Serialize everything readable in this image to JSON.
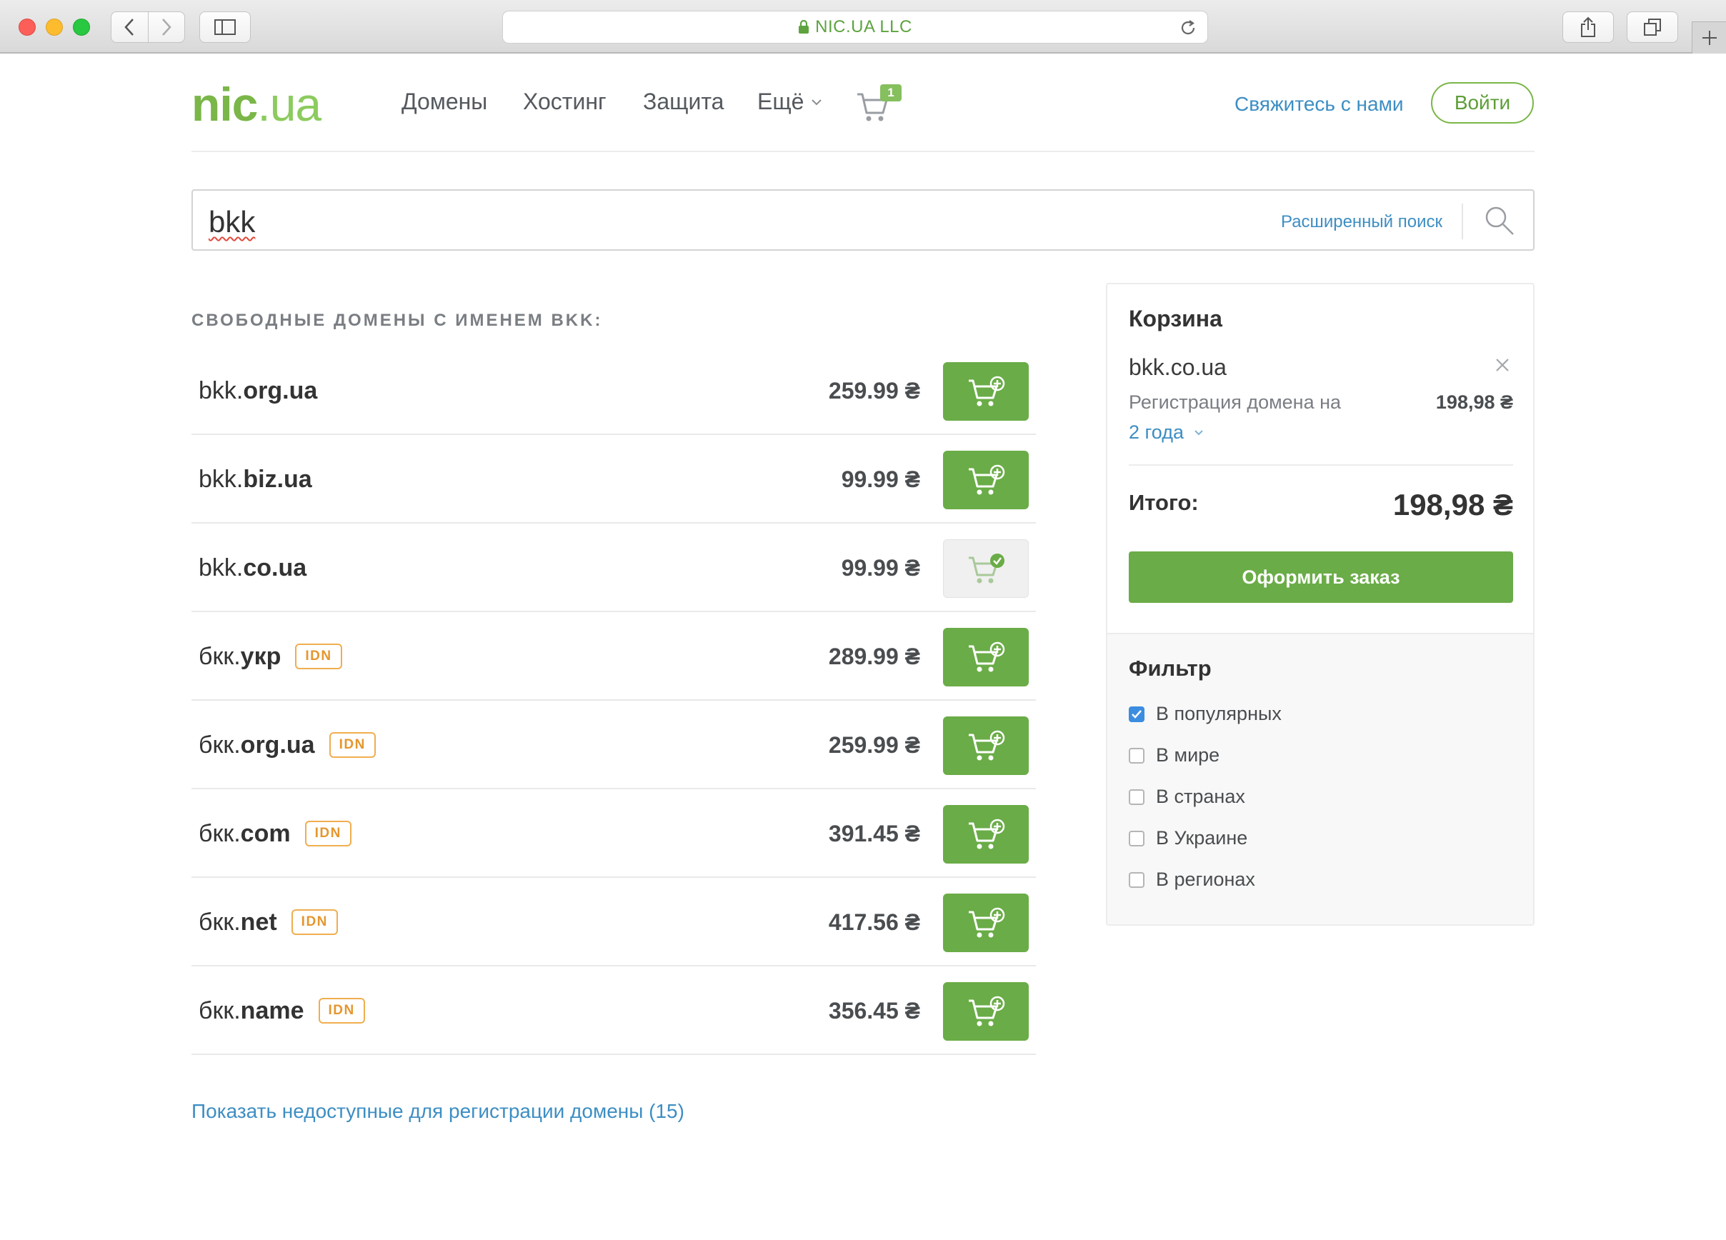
{
  "browser": {
    "url_text": "NIC.UA LLC"
  },
  "header": {
    "logo_main": "nic",
    "logo_suffix": ".ua",
    "nav": [
      "Домены",
      "Хостинг",
      "Защита",
      "Ещё"
    ],
    "cart_count": "1",
    "contact": "Свяжитесь с нами",
    "login": "Войти"
  },
  "search": {
    "value": "bkk",
    "advanced": "Расширенный поиск"
  },
  "results": {
    "title": "СВОБОДНЫЕ ДОМЕНЫ С ИМЕНЕМ BKK:",
    "rows": [
      {
        "name": "bkk.",
        "zone": "org.ua",
        "idn": "",
        "price": "259.99 ₴",
        "in_cart": false
      },
      {
        "name": "bkk.",
        "zone": "biz.ua",
        "idn": "",
        "price": "99.99 ₴",
        "in_cart": false
      },
      {
        "name": "bkk.",
        "zone": "co.ua",
        "idn": "",
        "price": "99.99 ₴",
        "in_cart": true
      },
      {
        "name": "бкк.",
        "zone": "укр",
        "idn": "IDN",
        "price": "289.99 ₴",
        "in_cart": false
      },
      {
        "name": "бкк.",
        "zone": "org.ua",
        "idn": "IDN",
        "price": "259.99 ₴",
        "in_cart": false
      },
      {
        "name": "бкк.",
        "zone": "com",
        "idn": "IDN",
        "price": "391.45 ₴",
        "in_cart": false
      },
      {
        "name": "бкк.",
        "zone": "net",
        "idn": "IDN",
        "price": "417.56 ₴",
        "in_cart": false
      },
      {
        "name": "бкк.",
        "zone": "name",
        "idn": "IDN",
        "price": "356.45 ₴",
        "in_cart": false
      }
    ],
    "show_unavailable": "Показать недоступные для регистрации домены (15)"
  },
  "basket": {
    "title": "Корзина",
    "domain": "bkk.co.ua",
    "registration_label": "Регистрация домена на",
    "registration_price": "198,98 ₴",
    "period": "2 года",
    "total_label": "Итого:",
    "total_value": "198,98 ₴",
    "order_button": "Оформить заказ"
  },
  "filter": {
    "title": "Фильтр",
    "options": [
      {
        "label": "В популярных",
        "checked": true
      },
      {
        "label": "В мире",
        "checked": false
      },
      {
        "label": "В странах",
        "checked": false
      },
      {
        "label": "В Украине",
        "checked": false
      },
      {
        "label": "В регионах",
        "checked": false
      }
    ]
  },
  "colors": {
    "accent_green": "#6aac47",
    "link_blue": "#3d8ec3",
    "idn_orange": "#e5962e"
  }
}
